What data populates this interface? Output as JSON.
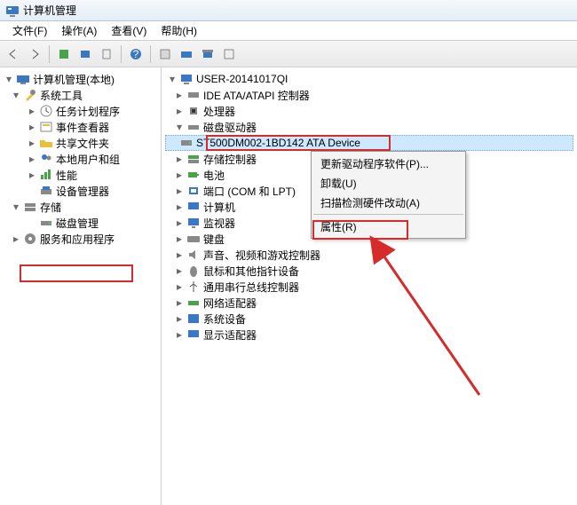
{
  "title": "计算机管理",
  "menubar": {
    "file": "文件(F)",
    "action": "操作(A)",
    "view": "查看(V)",
    "help": "帮助(H)"
  },
  "left_tree": {
    "root": "计算机管理(本地)",
    "system_tools": "系统工具",
    "task_scheduler": "任务计划程序",
    "event_viewer": "事件查看器",
    "shared_folders": "共享文件夹",
    "local_users_groups": "本地用户和组",
    "performance": "性能",
    "device_manager": "设备管理器",
    "storage": "存储",
    "disk_management": "磁盘管理",
    "services": "服务和应用程序"
  },
  "right_tree": {
    "computer": "USER-20141017QI",
    "ide_atapi": "IDE ATA/ATAPI 控制器",
    "processor": "处理器",
    "disk_drives": "磁盘驱动器",
    "disk_item": "ST500DM002-1BD142 ATA Device",
    "storage_ctrl": "存储控制器",
    "battery": "电池",
    "ports": "端口 (COM 和 LPT)",
    "computers": "计算机",
    "monitor": "监视器",
    "keyboard": "键盘",
    "audio": "声音、视频和游戏控制器",
    "mouse": "鼠标和其他指针设备",
    "usb": "通用串行总线控制器",
    "network": "网络适配器",
    "system_dev": "系统设备",
    "display": "显示适配器"
  },
  "context_menu": {
    "update_driver": "更新驱动程序软件(P)...",
    "uninstall": "卸载(U)",
    "scan": "扫描检测硬件改动(A)",
    "properties": "属性(R)"
  }
}
